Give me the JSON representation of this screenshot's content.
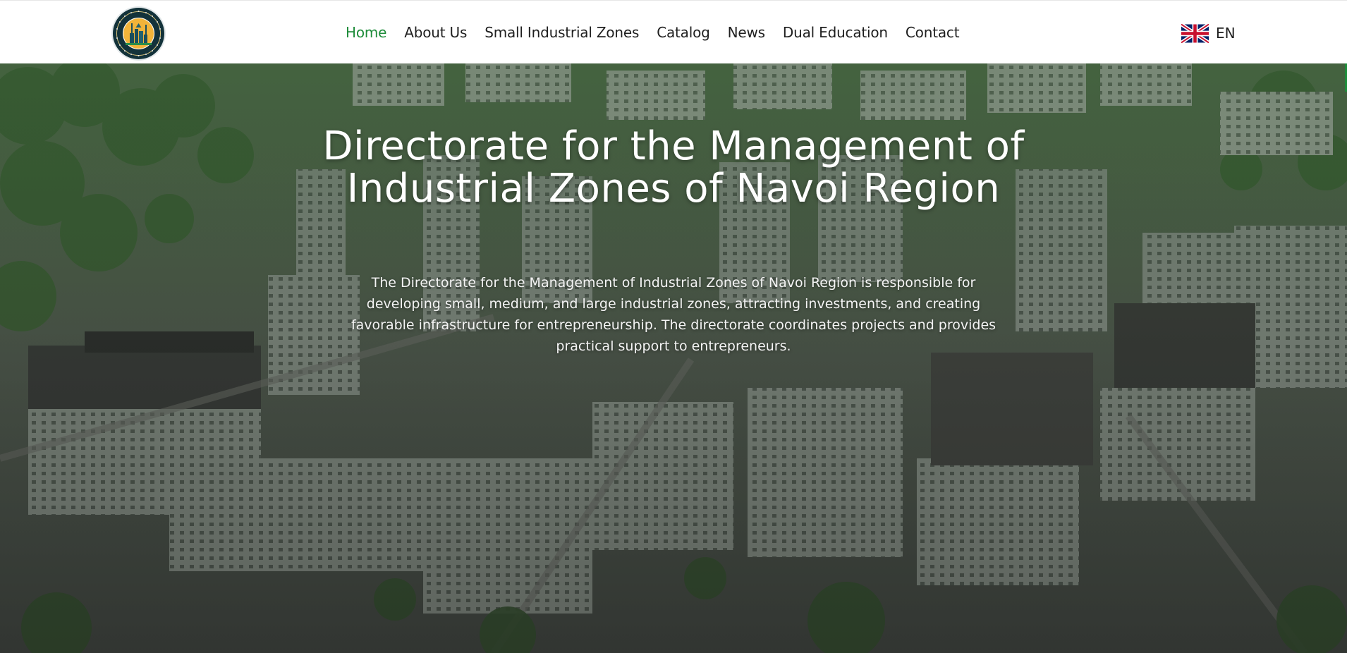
{
  "header": {
    "logo": {
      "icon": "organization-seal-icon",
      "alt": ""
    },
    "nav": [
      {
        "label": "Home",
        "active": true
      },
      {
        "label": "About Us",
        "active": false
      },
      {
        "label": "Small Industrial Zones",
        "active": false
      },
      {
        "label": "Catalog",
        "active": false
      },
      {
        "label": "News",
        "active": false
      },
      {
        "label": "Dual Education",
        "active": false
      },
      {
        "label": "Contact",
        "active": false
      }
    ],
    "language": {
      "code": "EN",
      "icon": "uk-flag-icon"
    }
  },
  "hero": {
    "title": "Directorate for the Management of Industrial Zones of Navoi Region",
    "description": "The Directorate for the Management of Industrial Zones of Navoi Region is responsible for developing small, medium, and large industrial zones, attracting investments, and creating favorable infrastructure for entrepreneurship. The directorate coordinates projects and provides practical support to entrepreneurs.",
    "background": "aerial-view-of-apartment-district-image"
  },
  "colors": {
    "accent": "#1e8c3a",
    "nav_text": "#1f1f1f",
    "hero_text": "#ffffff",
    "logo_dark": "#13323a"
  }
}
